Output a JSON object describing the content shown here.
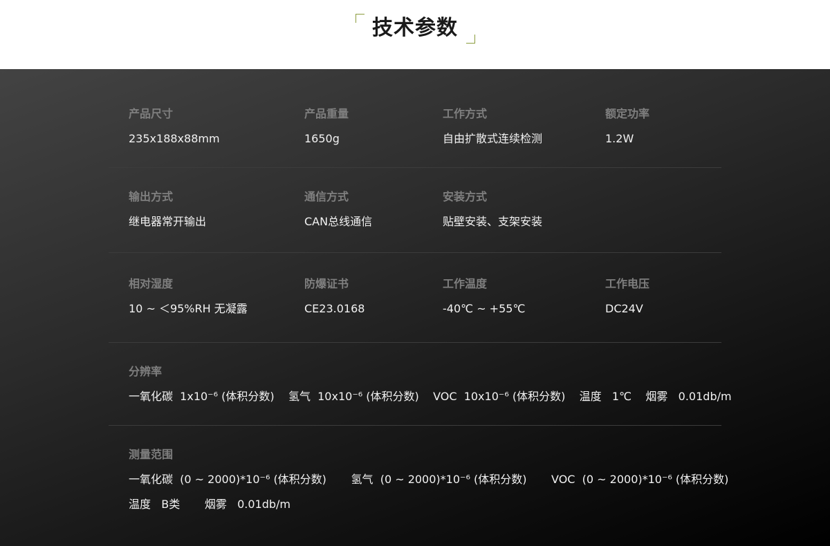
{
  "header": {
    "title": "技术参数"
  },
  "specs": {
    "size": {
      "label": "产品尺寸",
      "value": "235x188x88mm"
    },
    "weight": {
      "label": "产品重量",
      "value": "1650g"
    },
    "work_mode": {
      "label": "工作方式",
      "value": "自由扩散式连续检测"
    },
    "power": {
      "label": "额定功率",
      "value": "1.2W"
    },
    "output": {
      "label": "输出方式",
      "value": "继电器常开输出"
    },
    "comm": {
      "label": "通信方式",
      "value": "CAN总线通信"
    },
    "install": {
      "label": "安装方式",
      "value": "贴壁安装、支架安装"
    },
    "humidity": {
      "label": "相对湿度",
      "value": "10 ~ ＜95%RH 无凝露"
    },
    "explosion": {
      "label": "防爆证书",
      "value": "CE23.0168"
    },
    "temperature": {
      "label": "工作温度",
      "value": "-40℃ ~ +55℃"
    },
    "voltage": {
      "label": "工作电压",
      "value": "DC24V"
    }
  },
  "resolution": {
    "label": "分辨率",
    "value": "一氧化碳  1x10⁻⁶ (体积分数)    氢气  10x10⁻⁶ (体积分数)    VOC  10x10⁻⁶ (体积分数)    温度   1℃    烟雾   0.01db/m"
  },
  "range": {
    "label": "测量范围",
    "line1": "一氧化碳  (0 ~ 2000)*10⁻⁶ (体积分数)       氢气  (0 ~ 2000)*10⁻⁶ (体积分数)       VOC  (0 ~ 2000)*10⁻⁶ (体积分数)",
    "line2": "温度   B类       烟雾   0.01db/m"
  }
}
